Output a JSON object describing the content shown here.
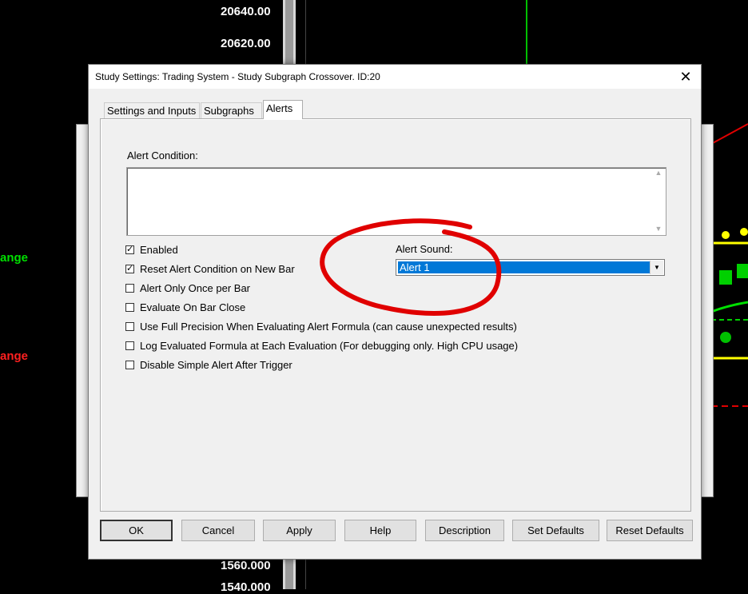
{
  "chart": {
    "prices_top": [
      "20640.00",
      "20620.00"
    ],
    "prices_bottom": [
      "1560.000",
      "1540.000"
    ],
    "side_labels": [
      {
        "text": "ange",
        "color": "#00e000"
      },
      {
        "text": "ange",
        "color": "#ff2020"
      }
    ]
  },
  "dialog": {
    "title": "Study Settings: Trading System - Study Subgraph Crossover. ID:20",
    "close_glyph": "✕",
    "tabs": [
      {
        "label": "Settings and Inputs"
      },
      {
        "label": "Subgraphs"
      },
      {
        "label": "Alerts",
        "active": true
      }
    ],
    "alert_condition_label": "Alert Condition:",
    "alert_condition_value": "",
    "checkboxes": [
      {
        "label": "Enabled",
        "checked": true
      },
      {
        "label": "Reset Alert Condition on New Bar",
        "checked": true
      },
      {
        "label": "Alert Only Once per Bar",
        "checked": false
      },
      {
        "label": "Evaluate On Bar Close",
        "checked": false
      },
      {
        "label": "Use Full Precision When Evaluating Alert Formula (can cause unexpected results)",
        "checked": false
      },
      {
        "label": "Log Evaluated Formula at Each Evaluation (For debugging only. High CPU usage)",
        "checked": false
      },
      {
        "label": "Disable Simple Alert After Trigger",
        "checked": false
      }
    ],
    "alert_sound_label": "Alert Sound:",
    "alert_sound_value": "Alert 1",
    "buttons": [
      "OK",
      "Cancel",
      "Apply",
      "Help",
      "Description",
      "Set Defaults",
      "Reset Defaults"
    ]
  },
  "colors": {
    "annotation": "#e00000",
    "selection": "#0078d7"
  }
}
